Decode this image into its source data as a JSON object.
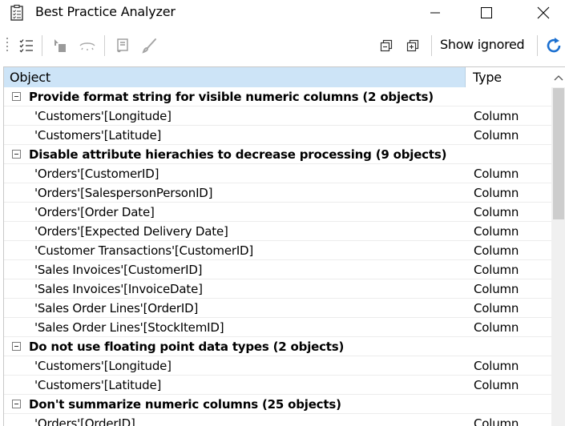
{
  "window": {
    "title": "Best Practice Analyzer",
    "app_icon": "checklist-clipboard-icon",
    "controls": [
      "minimize-icon",
      "maximize-icon",
      "close-icon"
    ]
  },
  "toolbar": {
    "icons": [
      "checklist-icon",
      "go-to-object-icon",
      "ignore-icon",
      "script-fix-icon",
      "apply-fix-icon",
      "collapse-all-icon",
      "expand-all-icon",
      "refresh-icon"
    ],
    "show_ignored_label": "Show ignored"
  },
  "grid": {
    "columns": [
      "Object",
      "Type"
    ],
    "rows": [
      {
        "kind": "group",
        "object": "Provide format string for visible numeric columns (2 objects)",
        "type": ""
      },
      {
        "kind": "item",
        "object": "'Customers'[Longitude]",
        "type": "Column"
      },
      {
        "kind": "item",
        "object": "'Customers'[Latitude]",
        "type": "Column"
      },
      {
        "kind": "group",
        "object": "Disable attribute hierachies to decrease processing (9 objects)",
        "type": ""
      },
      {
        "kind": "item",
        "object": "'Orders'[CustomerID]",
        "type": "Column"
      },
      {
        "kind": "item",
        "object": "'Orders'[SalespersonPersonID]",
        "type": "Column"
      },
      {
        "kind": "item",
        "object": "'Orders'[Order Date]",
        "type": "Column"
      },
      {
        "kind": "item",
        "object": "'Orders'[Expected Delivery Date]",
        "type": "Column"
      },
      {
        "kind": "item",
        "object": "'Customer Transactions'[CustomerID]",
        "type": "Column"
      },
      {
        "kind": "item",
        "object": "'Sales Invoices'[CustomerID]",
        "type": "Column"
      },
      {
        "kind": "item",
        "object": "'Sales Invoices'[InvoiceDate]",
        "type": "Column"
      },
      {
        "kind": "item",
        "object": "'Sales Order Lines'[OrderID]",
        "type": "Column"
      },
      {
        "kind": "item",
        "object": "'Sales Order Lines'[StockItemID]",
        "type": "Column"
      },
      {
        "kind": "group",
        "object": "Do not use floating point data types (2 objects)",
        "type": ""
      },
      {
        "kind": "item",
        "object": "'Customers'[Longitude]",
        "type": "Column"
      },
      {
        "kind": "item",
        "object": "'Customers'[Latitude]",
        "type": "Column"
      },
      {
        "kind": "group",
        "object": "Don't summarize numeric columns (25 objects)",
        "type": ""
      },
      {
        "kind": "item",
        "object": "'Orders'[OrderID]",
        "type": "Column"
      }
    ]
  },
  "colors": {
    "header_selected": "#cde4f7",
    "accent": "#1a6fd0"
  }
}
